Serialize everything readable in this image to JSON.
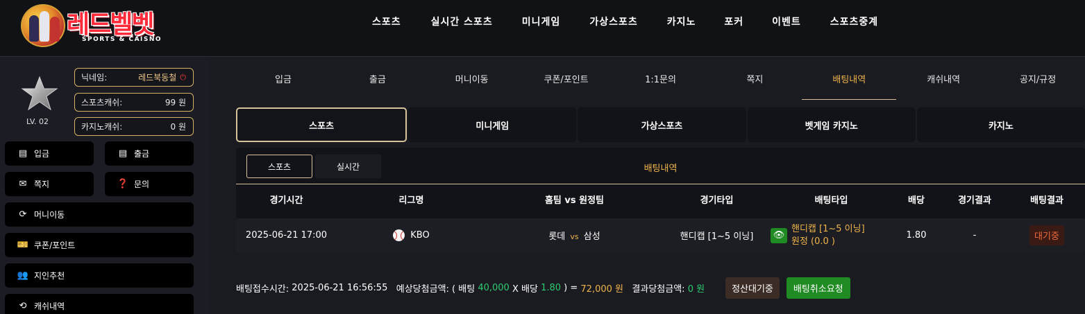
{
  "header": {
    "logo_text": "레드벨벳",
    "logo_sub": "SPORTS & CAISNO",
    "nav": [
      "스포츠",
      "실시간 스포츠",
      "미니게임",
      "가상스포츠",
      "카지노",
      "포커",
      "이벤트",
      "스포츠중계"
    ]
  },
  "user": {
    "level": "LV. 02",
    "nickname_label": "닉네임:",
    "nickname": "레드북동철",
    "sports_cash_label": "스포츠캐쉬:",
    "sports_cash": "99 원",
    "casino_cash_label": "카지노캐쉬:",
    "casino_cash": "0 원"
  },
  "sidebar": {
    "deposit": "입금",
    "withdraw": "출금",
    "message": "쪽지",
    "inquiry": "문의",
    "money_move": "머니이동",
    "coupon": "쿠폰/포인트",
    "referral": "지인추천",
    "cash_history": "캐쉬내역"
  },
  "account_tabs": [
    "입금",
    "출금",
    "머니이동",
    "쿠폰/포인트",
    "1:1문의",
    "쪽지",
    "배팅내역",
    "캐쉬내역",
    "공지/규정"
  ],
  "active_account_tab": "배팅내역",
  "category_tabs": [
    "스포츠",
    "미니게임",
    "가상스포츠",
    "벳게임 카지노",
    "카지노"
  ],
  "sub_tabs": [
    "스포츠",
    "실시간"
  ],
  "panel_title": "배팅내역",
  "table": {
    "headers": [
      "경기시간",
      "리그명",
      "홈팀 vs 원정팀",
      "경기타입",
      "배팅타입",
      "배당",
      "경기결과",
      "배팅결과"
    ],
    "row": {
      "time": "2025-06-21 17:00",
      "league": "KBO",
      "home": "롯데",
      "vs": "vs",
      "away": "삼성",
      "game_type": "핸디캡 [1~5 이닝]",
      "bet_type_line1": "핸디캡 [1~5 이닝]",
      "bet_type_line2": "원정 (0.0 )",
      "odds": "1.80",
      "game_result": "-",
      "bet_result": "대기중"
    }
  },
  "summary": {
    "received_label": "배팅접수시간:",
    "received_time": "2025-06-21 16:56:55",
    "expected_label": "예상당첨금액: ( 배팅",
    "stake": "40,000",
    "x_odds_label": "X 배당",
    "odds": "1.80",
    "eq": ") =",
    "expected_amount": "72,000 원",
    "result_label": "결과당첨금액:",
    "result_amount": "0 원",
    "settle_button": "정산대기중",
    "cancel_button": "배팅취소요청"
  },
  "colors": {
    "accent_gold": "#f0b44a",
    "border_gold": "#d8c39a",
    "green": "#1f8b22",
    "brand_red": "#ff2a3a"
  }
}
